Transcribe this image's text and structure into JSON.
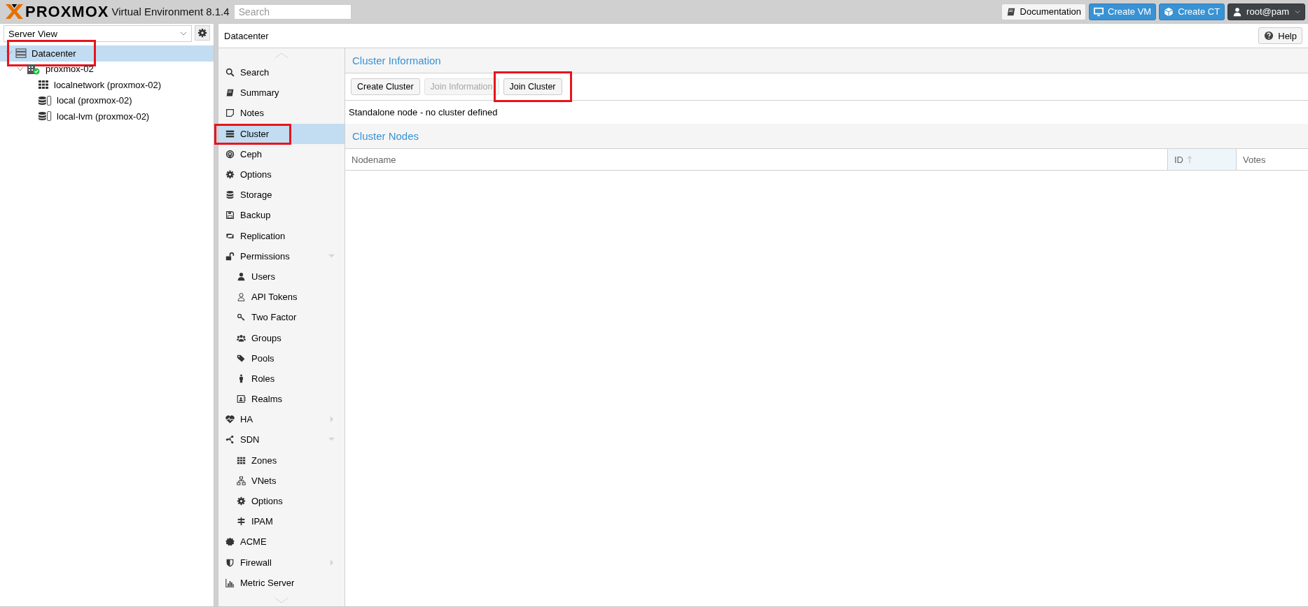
{
  "top_bar": {
    "logo": "PROXMOX",
    "version": "Virtual Environment 8.1.4",
    "search": {
      "placeholder": "Search"
    },
    "buttons": [
      {
        "label": "Documentation",
        "kind": "plain"
      },
      {
        "label": "Create VM",
        "kind": "primary"
      },
      {
        "label": "Create CT",
        "kind": "primary"
      },
      {
        "label": "root@pam",
        "kind": "user"
      }
    ]
  },
  "sidebar": {
    "view_selector": "Server View",
    "tree": [
      {
        "label": "Datacenter",
        "selected": true,
        "marked": true,
        "expanded": true,
        "children": [
          {
            "label": "proxmox-02",
            "selected": false,
            "marked": false,
            "expanded": true,
            "online": true,
            "children": [
              {
                "label": "localnetwork (proxmox-02)",
                "selected": false,
                "marked": false
              },
              {
                "label": "local (proxmox-02)",
                "selected": false,
                "marked": false
              },
              {
                "label": "local-lvm (proxmox-02)",
                "selected": false,
                "marked": false
              }
            ]
          }
        ]
      }
    ]
  },
  "content": {
    "title": "Datacenter",
    "help_button": "Help",
    "nav": [
      {
        "label": "Search",
        "selected": false,
        "marked": false
      },
      {
        "label": "Summary",
        "selected": false,
        "marked": false
      },
      {
        "label": "Notes",
        "selected": false,
        "marked": false
      },
      {
        "label": "Cluster",
        "selected": true,
        "marked": true
      },
      {
        "label": "Ceph",
        "selected": false,
        "marked": false
      },
      {
        "label": "Options",
        "selected": false,
        "marked": false
      },
      {
        "label": "Storage",
        "selected": false,
        "marked": false
      },
      {
        "label": "Backup",
        "selected": false,
        "marked": false
      },
      {
        "label": "Replication",
        "selected": false,
        "marked": false
      },
      {
        "label": "Permissions",
        "selected": false,
        "marked": false,
        "expanded": true,
        "children": [
          {
            "label": "Users",
            "selected": false,
            "marked": false
          },
          {
            "label": "API Tokens",
            "selected": false,
            "marked": false
          },
          {
            "label": "Two Factor",
            "selected": false,
            "marked": false
          },
          {
            "label": "Groups",
            "selected": false,
            "marked": false
          },
          {
            "label": "Pools",
            "selected": false,
            "marked": false
          },
          {
            "label": "Roles",
            "selected": false,
            "marked": false
          },
          {
            "label": "Realms",
            "selected": false,
            "marked": false
          }
        ]
      },
      {
        "label": "HA",
        "selected": false,
        "marked": false,
        "expanded": false
      },
      {
        "label": "SDN",
        "selected": false,
        "marked": false,
        "expanded": true,
        "children": [
          {
            "label": "Zones",
            "selected": false,
            "marked": false
          },
          {
            "label": "VNets",
            "selected": false,
            "marked": false
          },
          {
            "label": "Options",
            "selected": false,
            "marked": false
          },
          {
            "label": "IPAM",
            "selected": false,
            "marked": false
          }
        ]
      },
      {
        "label": "ACME",
        "selected": false,
        "marked": false
      },
      {
        "label": "Firewall",
        "selected": false,
        "marked": false,
        "expanded": false
      },
      {
        "label": "Metric Server",
        "selected": false,
        "marked": false
      }
    ],
    "cluster_information": {
      "title": "Cluster Information",
      "buttons": [
        {
          "label": "Create Cluster",
          "disabled": false,
          "marked": false
        },
        {
          "label": "Join Information",
          "disabled": true,
          "marked": false
        },
        {
          "label": "Join Cluster",
          "disabled": false,
          "marked": true
        }
      ],
      "status": "Standalone node - no cluster defined"
    },
    "cluster_nodes": {
      "title": "Cluster Nodes",
      "columns": [
        {
          "label": "Nodename",
          "sorted": false
        },
        {
          "label": "ID",
          "sorted": true
        },
        {
          "label": "Votes",
          "sorted": false
        }
      ]
    }
  }
}
